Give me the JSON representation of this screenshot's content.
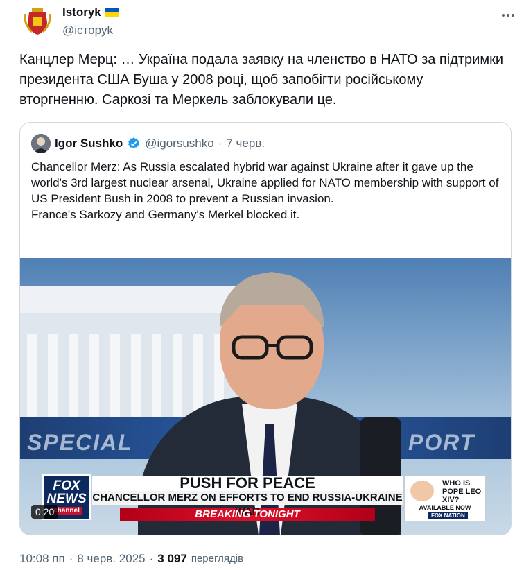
{
  "author": {
    "display_name": "Istoryk",
    "handle": "@історyk",
    "avatar": "coat-of-arms-icon",
    "flag": "ukraine-flag-icon"
  },
  "tweet": {
    "text": "Канцлер Мерц: … Україна подала заявку на членство в НАТО за підтримки президента США Буша у 2008 році, щоб запобігти російському вторгненню. Саркозі та Меркель заблокували це."
  },
  "quoted": {
    "display_name": "Igor Sushko",
    "handle": "@igorsushko",
    "separator": "·",
    "date": "7 черв.",
    "text": "Chancellor Merz: As Russia escalated hybrid war against Ukraine after it gave up the world's 3rd largest nuclear arsenal, Ukraine applied for NATO membership with support of US President Bush in 2008 to prevent a Russian invasion.\nFrance's Sarkozy and Germany's Merkel blocked it.",
    "video": {
      "timer": "0:20",
      "bg_left": "SPECIAL",
      "bg_right": "PORT",
      "logo_top": "FOX",
      "logo_mid": "NEWS",
      "logo_ch": "channel",
      "headline": "PUSH FOR PEACE",
      "subhead": "CHANCELLOR MERZ ON EFFORTS TO END RUSSIA-UKRAINE WAR",
      "tag": "BREAKING TONIGHT",
      "promo_title": "WHO IS POPE LEO XIV?",
      "promo_sub": "AVAILABLE NOW",
      "promo_brand": "FOX NATION"
    }
  },
  "meta": {
    "time": "10:08 пп",
    "separator": "·",
    "date": "8 черв. 2025",
    "separator2": "·",
    "views": "3 097",
    "views_label": "переглядів"
  },
  "colors": {
    "verified": "#1d9bf0",
    "secondary_text": "#536471",
    "border": "#cfd9de"
  }
}
